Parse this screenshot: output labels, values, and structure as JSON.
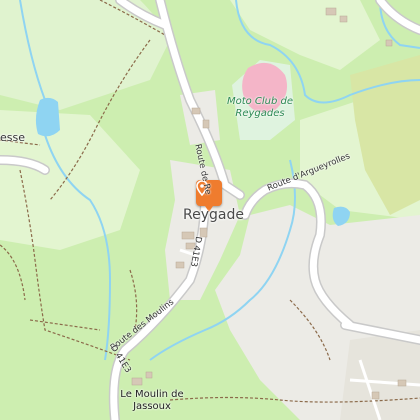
{
  "map": {
    "place_label": "Reygade",
    "leisure_label": "Moto Club de Reygades",
    "hamlet_label": "Le Moulin de Jassoux",
    "partial_label": "esse",
    "road_labels": [
      "Route de Re",
      "D 41E3",
      "Route d'Argueyrolles",
      "Route des Moulins",
      "D 41E3"
    ],
    "marker": {
      "icon": "location-pin-icon",
      "color": "#ef7c2e"
    },
    "colors": {
      "forest": "#cdeeb0",
      "meadow": "#e3f5d0",
      "farmland": "#d8e6a5",
      "residential": "#ecebe6",
      "road": "#ffffff",
      "water": "#8fd4f2",
      "racetrack": "#f4b5c8"
    }
  }
}
